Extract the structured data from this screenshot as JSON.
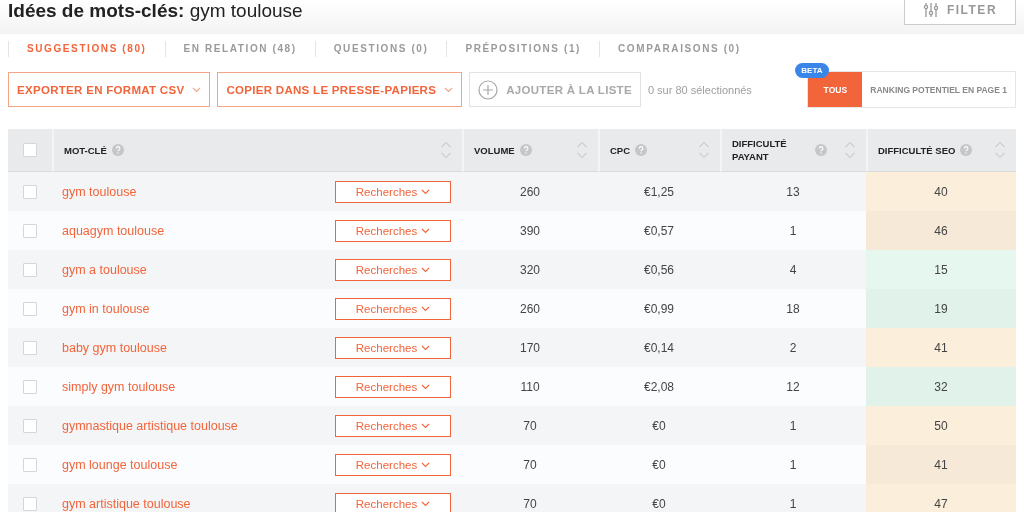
{
  "header": {
    "title_bold": "Idées de mots-clés:",
    "query": "gym toulouse",
    "filter_button": "FILTER"
  },
  "tabs": [
    {
      "label": "SUGGESTIONS (80)",
      "selected": true
    },
    {
      "label": "EN RELATION (48)",
      "selected": false
    },
    {
      "label": "QUESTIONS (0)",
      "selected": false
    },
    {
      "label": "PRÉPOSITIONS (1)",
      "selected": false
    },
    {
      "label": "COMPARAISONS (0)",
      "selected": false
    }
  ],
  "toolbar": {
    "export_button": "EXPORTER EN FORMAT CSV",
    "copy_button": "COPIER DANS LE PRESSE-PAPIERS",
    "add_button": {
      "label": "AJOUTER À LA LISTE",
      "disabled": true
    },
    "selection_count": "0 sur 80 sélectionnés",
    "beta_badge": "BETA",
    "view_toggle": [
      {
        "label": "TOUS",
        "selected": true
      },
      {
        "label": "RANKING POTENTIEL EN PAGE 1",
        "selected": false
      }
    ]
  },
  "table": {
    "select_all_checked": false,
    "columns": [
      "MOT-CLÉ",
      "VOLUME",
      "CPC",
      "DIFFICULTÉ PAYANT",
      "DIFFICULTÉ SEO"
    ],
    "rows": [
      {
        "keyword": "gym toulouse",
        "searches_button": "Recherches",
        "volume": "260",
        "cpc": "€1,25",
        "paid_difficulty": "13",
        "seo_difficulty": "40",
        "color": "#fbeedb",
        "checked": false
      },
      {
        "keyword": "aquagym toulouse",
        "searches_button": "Recherches",
        "volume": "390",
        "cpc": "€0,57",
        "paid_difficulty": "1",
        "seo_difficulty": "46",
        "color": "#f6e9d7",
        "checked": false
      },
      {
        "keyword": "gym a toulouse",
        "searches_button": "Recherches",
        "volume": "320",
        "cpc": "€0,56",
        "paid_difficulty": "4",
        "seo_difficulty": "15",
        "color": "#e6f7f0",
        "checked": false
      },
      {
        "keyword": "gym in toulouse",
        "searches_button": "Recherches",
        "volume": "260",
        "cpc": "€0,99",
        "paid_difficulty": "18",
        "seo_difficulty": "19",
        "color": "#e0f2ea",
        "checked": false
      },
      {
        "keyword": "baby gym toulouse",
        "searches_button": "Recherches",
        "volume": "170",
        "cpc": "€0,14",
        "paid_difficulty": "2",
        "seo_difficulty": "41",
        "color": "#fbeedb",
        "checked": false
      },
      {
        "keyword": "simply gym toulouse",
        "searches_button": "Recherches",
        "volume": "110",
        "cpc": "€2,08",
        "paid_difficulty": "12",
        "seo_difficulty": "32",
        "color": "#e0f2ea",
        "checked": false
      },
      {
        "keyword": "gymnastique artistique toulouse",
        "searches_button": "Recherches",
        "volume": "70",
        "cpc": "€0",
        "paid_difficulty": "1",
        "seo_difficulty": "50",
        "color": "#fbeedb",
        "checked": false
      },
      {
        "keyword": "gym lounge toulouse",
        "searches_button": "Recherches",
        "volume": "70",
        "cpc": "€0",
        "paid_difficulty": "1",
        "seo_difficulty": "41",
        "color": "#f6e9d7",
        "checked": false
      },
      {
        "keyword": "gym artistique toulouse",
        "searches_button": "Recherches",
        "volume": "70",
        "cpc": "€0",
        "paid_difficulty": "1",
        "seo_difficulty": "47",
        "color": "#fbeedb",
        "checked": false
      }
    ]
  }
}
